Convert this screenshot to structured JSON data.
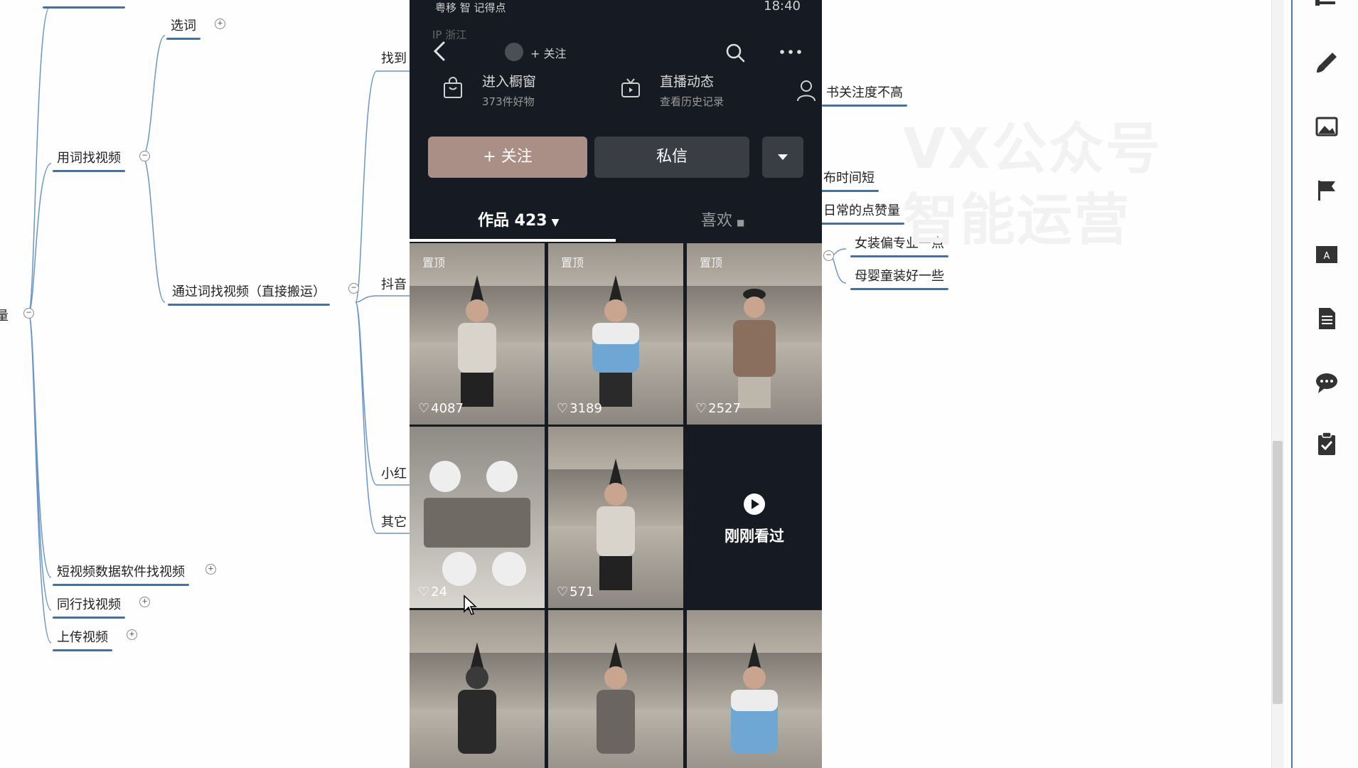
{
  "mindmap": {
    "root_partial": "量",
    "choose_word": "选词",
    "find_by_word": "用词找视频",
    "find_by_word_direct": "通过词找视频（直接搬运）",
    "find_partial": "找到",
    "douyin_partial": "抖音",
    "xiaohongshu_partial": "小红",
    "other_partial": "其它",
    "short_video_software": "短视频数据软件找视频",
    "peer_find": "同行找视频",
    "upload_video": "上传视频",
    "xhs_attention_low": "书关注度不高",
    "publish_time_short": "布时间短",
    "daily_likes": "日常的点赞量",
    "women_pro": "女装偏专业一点",
    "baby_better": "母婴童装好一些"
  },
  "watermark": {
    "line1": "VX公众号",
    "line2": "智能运营"
  },
  "phone": {
    "status_left": "粤移 智 记得点",
    "status_time": "18:40",
    "ip_location": "IP  浙江",
    "nav_follow": "+ 关注",
    "shop_title": "进入橱窗",
    "shop_sub": "373件好物",
    "live_title": "直播动态",
    "live_sub": "查看历史记录",
    "follow_button": "+ 关注",
    "message_button": "私信",
    "tab_works": "作品 423",
    "tab_likes": "喜欢",
    "pinned_label": "置顶",
    "just_watched": "刚刚看过",
    "video_likes": [
      "4087",
      "3189",
      "2527",
      "24",
      "571"
    ]
  },
  "colors": {
    "phone_bg": "#161a22",
    "follow_btn": "#a98f85",
    "mindmap_line": "#3a73b5"
  },
  "icons": [
    "back-icon",
    "search-icon",
    "more-icon",
    "shopping-bag-icon",
    "tv-icon",
    "user-icon",
    "chevron-down-icon",
    "play-icon",
    "heart-icon",
    "lock-icon",
    "minus-icon",
    "paint-brush-icon",
    "image-icon",
    "flag-icon",
    "font-icon",
    "document-icon",
    "chat-icon",
    "clipboard-icon"
  ]
}
